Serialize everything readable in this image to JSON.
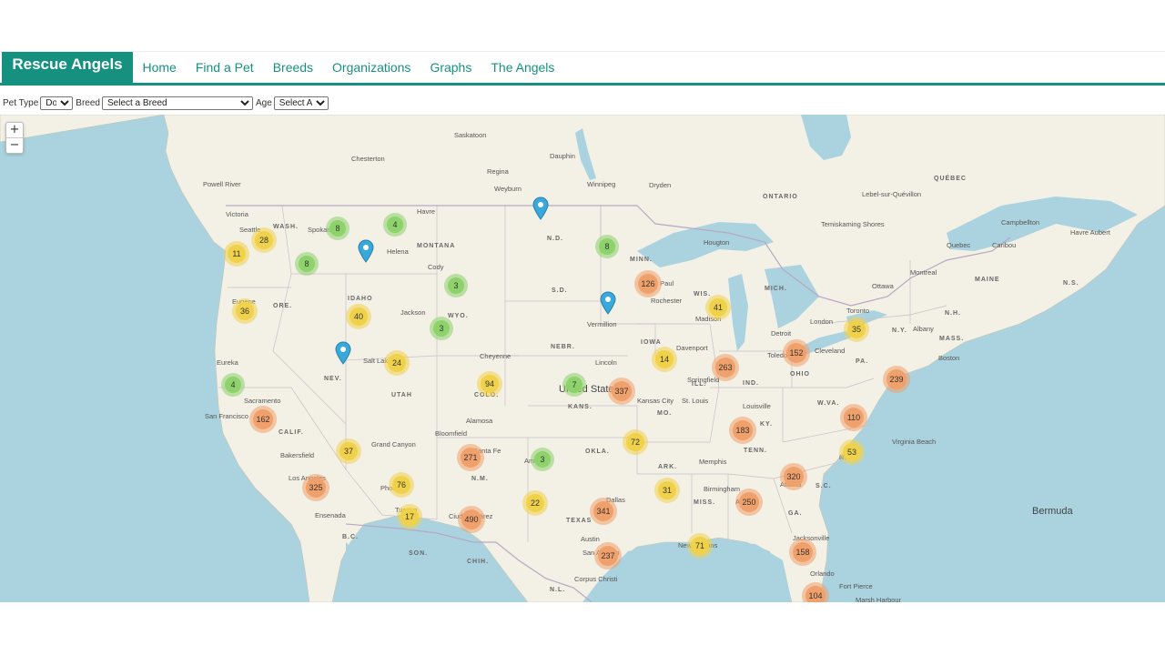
{
  "brand": "Rescue Angels",
  "nav": [
    "Home",
    "Find a Pet",
    "Breeds",
    "Organizations",
    "Graphs",
    "The Angels"
  ],
  "filters": {
    "pet_type_label": "Pet Type",
    "pet_type_value": "Dogs",
    "breed_label": "Breed",
    "breed_value": "Select a Breed",
    "age_label": "Age",
    "age_value": "Select Age"
  },
  "zoom": {
    "in": "+",
    "out": "−"
  },
  "colors": {
    "brand": "#17917f",
    "water": "#aad3df",
    "land": "#f2efe4",
    "cluster_small": "#8dd26a",
    "cluster_medium": "#f0d24a",
    "cluster_large": "#f0a06a",
    "pin": "#38a9dc"
  },
  "clusters": [
    {
      "count": "8",
      "size": "small"
    },
    {
      "count": "4",
      "size": "small"
    },
    {
      "count": "28",
      "size": "medium"
    },
    {
      "count": "11",
      "size": "medium"
    },
    {
      "count": "8",
      "size": "small"
    },
    {
      "count": "8",
      "size": "small"
    },
    {
      "count": "3",
      "size": "small"
    },
    {
      "count": "126",
      "size": "large"
    },
    {
      "count": "36",
      "size": "medium"
    },
    {
      "count": "40",
      "size": "medium"
    },
    {
      "count": "3",
      "size": "small"
    },
    {
      "count": "41",
      "size": "medium"
    },
    {
      "count": "35",
      "size": "medium"
    },
    {
      "count": "152",
      "size": "large"
    },
    {
      "count": "24",
      "size": "medium"
    },
    {
      "count": "14",
      "size": "medium"
    },
    {
      "count": "263",
      "size": "large"
    },
    {
      "count": "239",
      "size": "large"
    },
    {
      "count": "4",
      "size": "small"
    },
    {
      "count": "94",
      "size": "medium"
    },
    {
      "count": "7",
      "size": "small"
    },
    {
      "count": "337",
      "size": "large"
    },
    {
      "count": "162",
      "size": "large"
    },
    {
      "count": "110",
      "size": "large"
    },
    {
      "count": "183",
      "size": "large"
    },
    {
      "count": "72",
      "size": "medium"
    },
    {
      "count": "37",
      "size": "medium"
    },
    {
      "count": "271",
      "size": "large"
    },
    {
      "count": "3",
      "size": "small"
    },
    {
      "count": "53",
      "size": "medium"
    },
    {
      "count": "76",
      "size": "medium"
    },
    {
      "count": "31",
      "size": "medium"
    },
    {
      "count": "320",
      "size": "large"
    },
    {
      "count": "325",
      "size": "large"
    },
    {
      "count": "22",
      "size": "medium"
    },
    {
      "count": "341",
      "size": "large"
    },
    {
      "count": "250",
      "size": "large"
    },
    {
      "count": "17",
      "size": "medium"
    },
    {
      "count": "490",
      "size": "large"
    },
    {
      "count": "237",
      "size": "large"
    },
    {
      "count": "71",
      "size": "medium"
    },
    {
      "count": "158",
      "size": "large"
    },
    {
      "count": "104",
      "size": "large"
    }
  ],
  "pins": [
    {
      "name": "pin-north-dakota"
    },
    {
      "name": "pin-montana"
    },
    {
      "name": "pin-south-dakota"
    },
    {
      "name": "pin-nevada"
    }
  ],
  "labels": {
    "countries": [
      "United States",
      "Bermuda"
    ],
    "regions": [
      "WASH.",
      "MONTANA",
      "N.D.",
      "MINN.",
      "ONTARIO",
      "QUÉBEC",
      "ORE.",
      "IDAHO",
      "WYO.",
      "S.D.",
      "WIS.",
      "MICH.",
      "MAINE",
      "N.S.",
      "N.H.",
      "MASS.",
      "N.Y.",
      "NEBR.",
      "IOWA",
      "NEV.",
      "UTAH",
      "COLO.",
      "KANS.",
      "MO.",
      "ILL.",
      "IND.",
      "OHIO",
      "PA.",
      "W.VA.",
      "KY.",
      "TENN.",
      "N.C.",
      "S.C.",
      "CALIF.",
      "OKLA.",
      "ARK.",
      "MISS.",
      "AL.",
      "GA.",
      "N.M.",
      "TEXAS",
      "B.C.",
      "SON.",
      "CHIH.",
      "N.L."
    ],
    "cities": [
      "Saskatoon",
      "Chesterton",
      "Dauphin",
      "Regina",
      "Winnipeg",
      "Weyburn",
      "Dryden",
      "Powell River",
      "Victoria",
      "Seattle",
      "Spokane",
      "Havre",
      "Helena",
      "Hougton",
      "Temiskaming Shores",
      "Campbellton",
      "Havre Aubert",
      "Quebec",
      "Caribou",
      "Lebel-sur-Quévillon",
      "Eugene",
      "Cody",
      "Jackson",
      "Vermillion",
      "Rochester",
      "St Paul",
      "Madison",
      "Ottawa",
      "Montreal",
      "Toronto",
      "London",
      "Detroit",
      "Albany",
      "Boston",
      "Cleveland",
      "Toledo",
      "Davenport",
      "Lincoln",
      "Cheyenne",
      "Salt Lake City",
      "Eureka",
      "Sacramento",
      "San Francisco",
      "Bakersfield",
      "Grand Canyon",
      "Bloomfield",
      "Alamosa",
      "Santa Fe",
      "Amarillo",
      "Kansas City",
      "St. Louis",
      "Springfield",
      "Louisville",
      "Virginia Beach",
      "Memphis",
      "Birmingham",
      "Atlanta",
      "Los Angeles",
      "Phoenix",
      "Tucson",
      "Ensenada",
      "Ciudad Juárez",
      "Dallas",
      "Austin",
      "San Antonio",
      "Corpus Christi",
      "New Orleans",
      "Jacksonville",
      "Marsh Harbour",
      "Orlando",
      "Fort Pierce"
    ]
  }
}
